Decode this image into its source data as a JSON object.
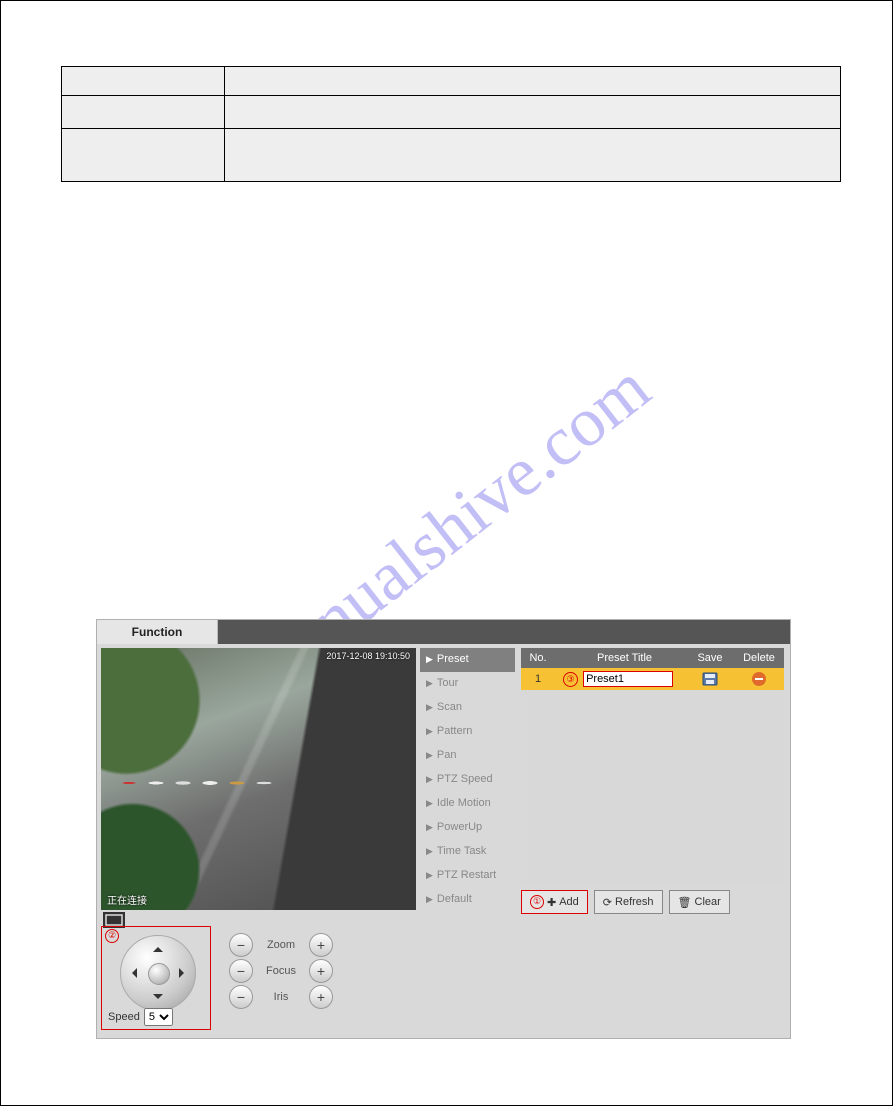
{
  "watermark": "manualshive.com",
  "top_table": {
    "headers": [
      "",
      ""
    ],
    "rows": [
      [
        "",
        ""
      ],
      [
        "",
        ""
      ]
    ]
  },
  "ui": {
    "tab_label": "Function",
    "osd_top": "2017-12-08 19:10:50",
    "osd_bottom": "正在连接",
    "menu": [
      {
        "label": "Preset",
        "active": true
      },
      {
        "label": "Tour",
        "active": false
      },
      {
        "label": "Scan",
        "active": false
      },
      {
        "label": "Pattern",
        "active": false
      },
      {
        "label": "Pan",
        "active": false
      },
      {
        "label": "PTZ Speed",
        "active": false
      },
      {
        "label": "Idle Motion",
        "active": false
      },
      {
        "label": "PowerUp",
        "active": false
      },
      {
        "label": "Time Task",
        "active": false
      },
      {
        "label": "PTZ Restart",
        "active": false
      },
      {
        "label": "Default",
        "active": false
      }
    ],
    "preset_table": {
      "headers": {
        "no": "No.",
        "title": "Preset Title",
        "save": "Save",
        "del": "Delete"
      },
      "rows": [
        {
          "no": "1",
          "title": "Preset1",
          "callout": "③"
        }
      ]
    },
    "buttons": {
      "add": "Add",
      "add_callout": "①",
      "refresh": "Refresh",
      "clear": "Clear"
    },
    "controls": {
      "callout": "②",
      "speed_label": "Speed",
      "speed_value": "5",
      "zoom": "Zoom",
      "focus": "Focus",
      "iris": "Iris"
    }
  }
}
